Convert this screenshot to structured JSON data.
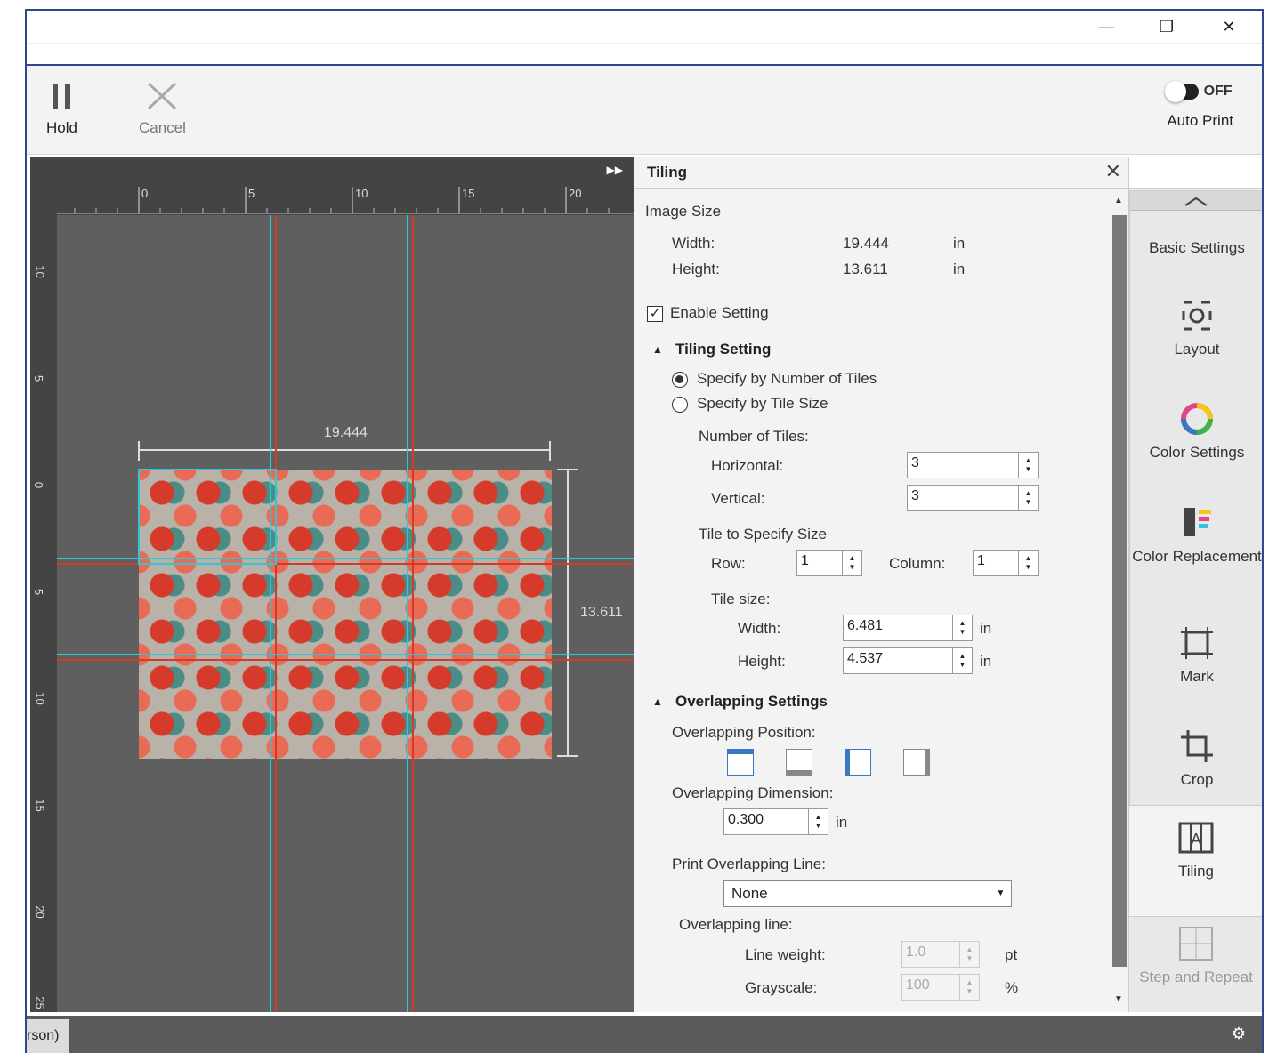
{
  "toolbar": {
    "hold_label": "Hold",
    "cancel_label": "Cancel",
    "auto_print_label": "Auto Print",
    "auto_print_state": "OFF"
  },
  "canvas": {
    "h_ruler_ticks": [
      "0",
      "5",
      "10",
      "15",
      "20"
    ],
    "v_ruler_ticks": [
      "10",
      "5",
      "0",
      "5",
      "10",
      "15",
      "20",
      "25"
    ],
    "width_dim": "19.444",
    "height_dim": "13.611"
  },
  "panel": {
    "title": "Tiling",
    "image_size_label": "Image Size",
    "width_label": "Width:",
    "width_value": "19.444",
    "height_label": "Height:",
    "height_value": "13.611",
    "unit_in": "in",
    "enable_setting_label": "Enable Setting",
    "tiling_setting_label": "Tiling Setting",
    "radio_by_number": "Specify by Number of Tiles",
    "radio_by_size": "Specify by Tile Size",
    "number_of_tiles_label": "Number of Tiles:",
    "horizontal_label": "Horizontal:",
    "horizontal_value": "3",
    "vertical_label": "Vertical:",
    "vertical_value": "3",
    "tile_to_specify_label": "Tile to Specify Size",
    "row_label": "Row:",
    "row_value": "1",
    "column_label": "Column:",
    "column_value": "1",
    "tile_size_label": "Tile size:",
    "tile_width_label": "Width:",
    "tile_width_value": "6.481",
    "tile_height_label": "Height:",
    "tile_height_value": "4.537",
    "overlapping_settings_label": "Overlapping Settings",
    "overlapping_position_label": "Overlapping Position:",
    "overlapping_dimension_label": "Overlapping Dimension:",
    "overlapping_dimension_value": "0.300",
    "print_overlapping_line_label": "Print Overlapping Line:",
    "print_overlapping_line_value": "None",
    "overlapping_line_label": "Overlapping line:",
    "line_weight_label": "Line weight:",
    "line_weight_value": "1.0",
    "line_weight_unit": "pt",
    "grayscale_label": "Grayscale:",
    "grayscale_value": "100",
    "grayscale_unit": "%"
  },
  "sidebar": {
    "items": [
      {
        "label": "Basic Settings"
      },
      {
        "label": "Layout"
      },
      {
        "label": "Color Settings"
      },
      {
        "label": "Color Replacement"
      },
      {
        "label": "Mark"
      },
      {
        "label": "Crop"
      },
      {
        "label": "Tiling"
      },
      {
        "label": "Step and Repeat"
      }
    ]
  },
  "statusbar": {
    "tab_label": "rson)"
  },
  "colors": {
    "guide_cyan": "#2fc6d6",
    "guide_red": "#d23a2a",
    "window_border": "#2b4a8a"
  }
}
